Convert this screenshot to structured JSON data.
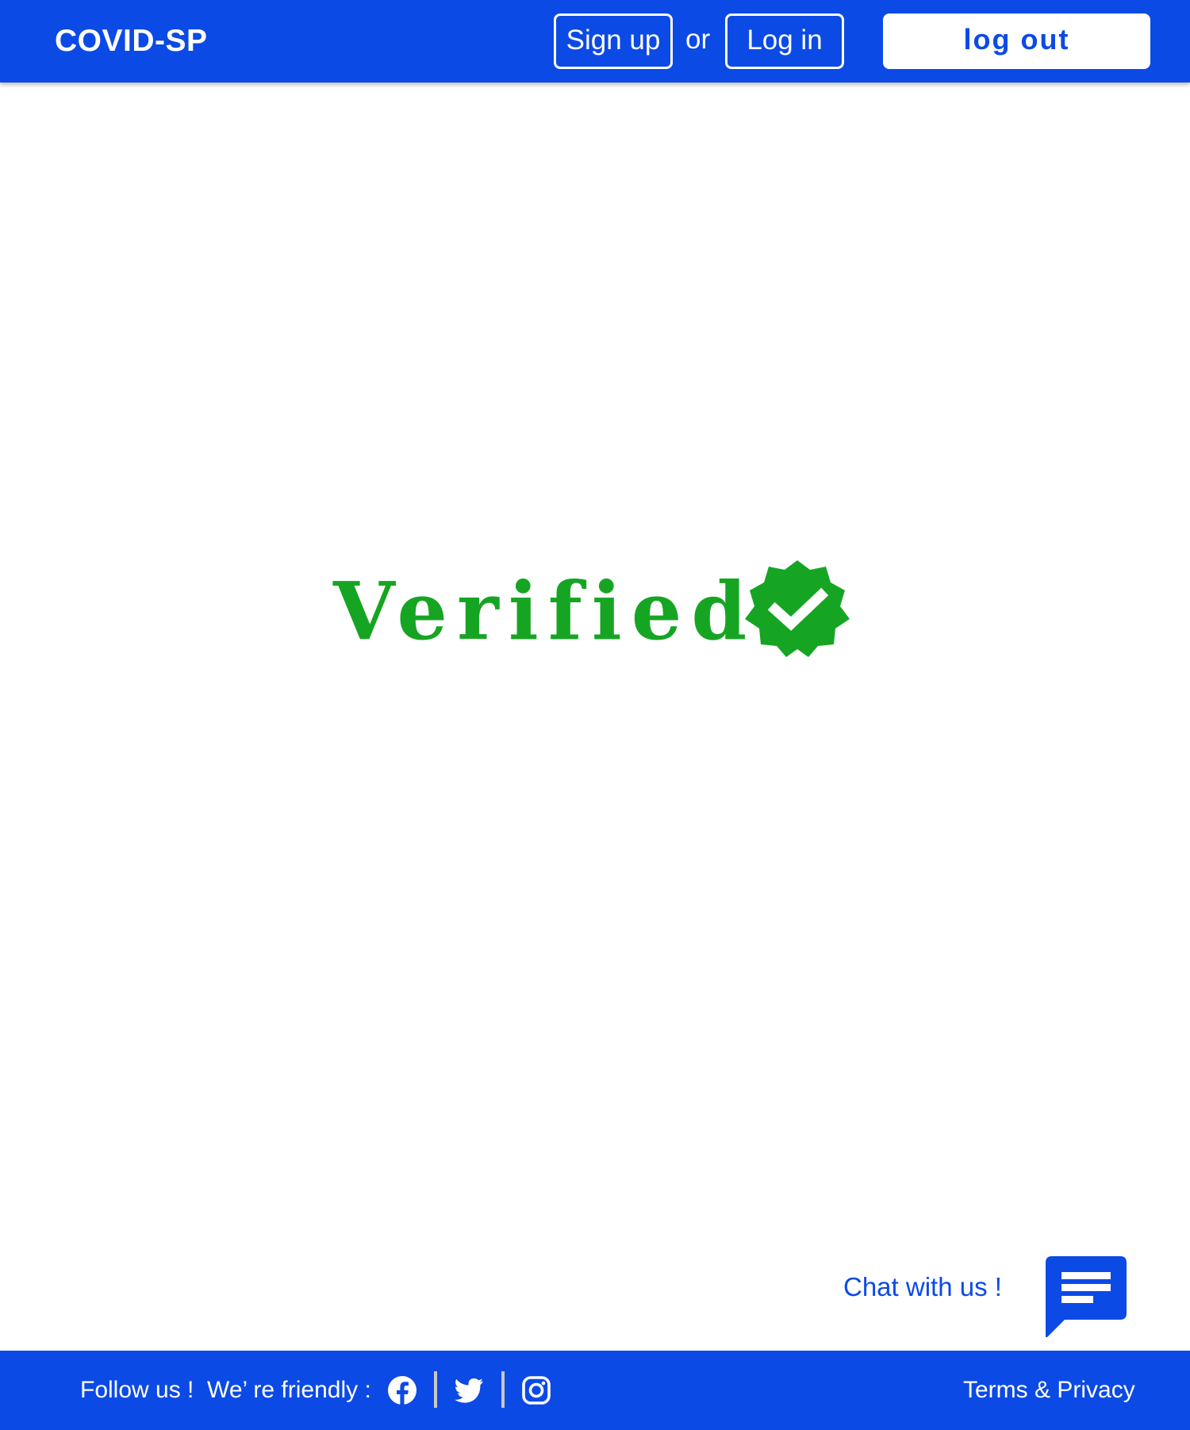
{
  "header": {
    "brand": "COVID-SP",
    "signup_label": "Sign up",
    "or_text": "or",
    "login_label": "Log in",
    "logout_label": "log out"
  },
  "main": {
    "verified_text": "Verified",
    "badge_icon": "verified-badge-icon"
  },
  "chat": {
    "label": "Chat with us !",
    "icon": "chat-bubble-icon"
  },
  "footer": {
    "follow_text": "Follow us !  We’ re friendly :",
    "social_icons": [
      "facebook-icon",
      "twitter-icon",
      "instagram-icon"
    ],
    "terms_label": "Terms & Privacy"
  },
  "colors": {
    "primary_blue": "#0c4ae6",
    "verified_green": "#16a523",
    "white": "#ffffff",
    "divider_gray": "#c9c9c9"
  }
}
